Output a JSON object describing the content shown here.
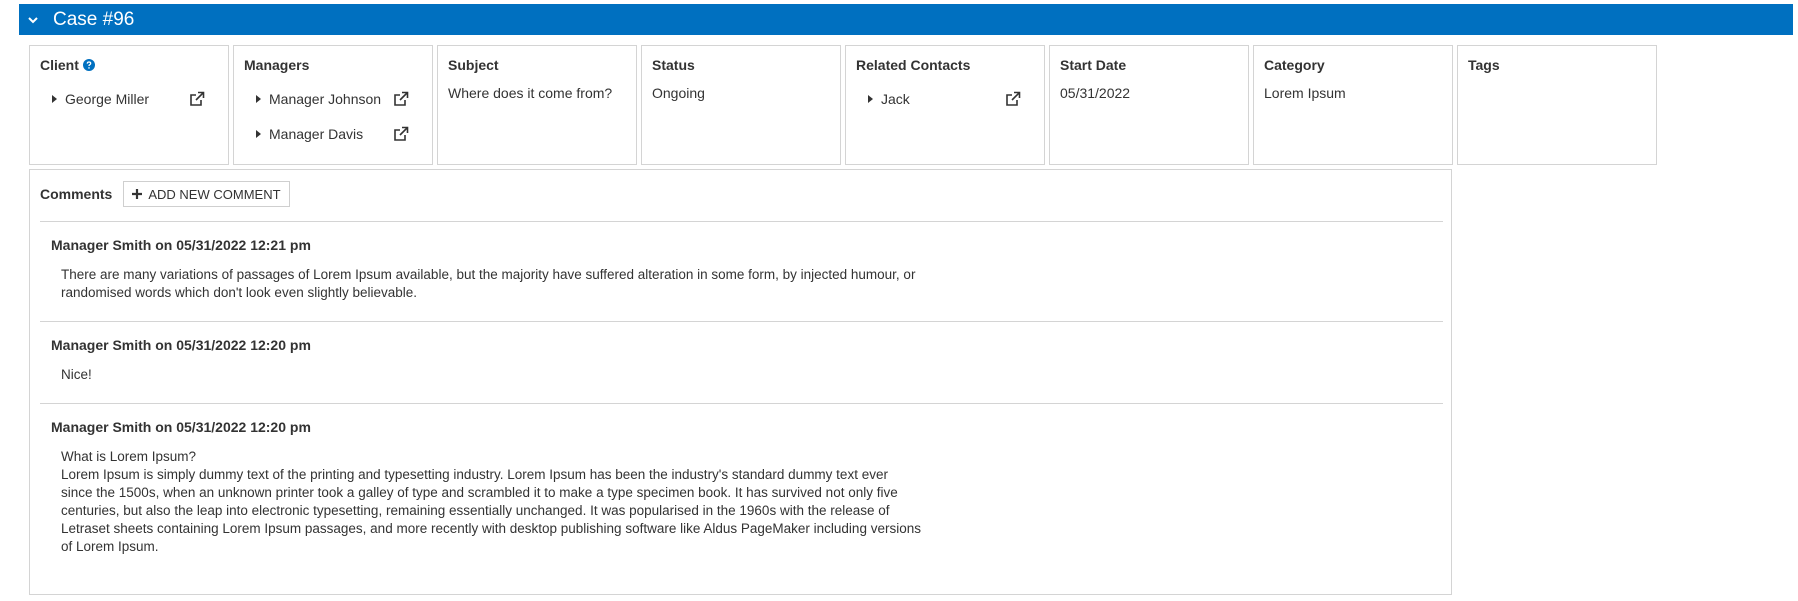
{
  "header": {
    "title": "Case #96"
  },
  "fields": {
    "client": {
      "label": "Client",
      "people": [
        {
          "name": "George Miller"
        }
      ]
    },
    "managers": {
      "label": "Managers",
      "people": [
        {
          "name": "Manager Johnson"
        },
        {
          "name": "Manager Davis"
        }
      ]
    },
    "subject": {
      "label": "Subject",
      "value": "Where does it come from?"
    },
    "status": {
      "label": "Status",
      "value": "Ongoing"
    },
    "related_contacts": {
      "label": "Related Contacts",
      "people": [
        {
          "name": "Jack"
        }
      ]
    },
    "start_date": {
      "label": "Start Date",
      "value": "05/31/2022"
    },
    "category": {
      "label": "Category",
      "value": "Lorem Ipsum"
    },
    "tags": {
      "label": "Tags"
    }
  },
  "comments": {
    "title": "Comments",
    "add_label": "ADD NEW COMMENT",
    "items": [
      {
        "author": "Manager Smith on 05/31/2022 12:21 pm",
        "body": "There are many variations of passages of Lorem Ipsum available, but the majority have suffered alteration in some form, by injected humour, or\nrandomised words which don't look even slightly believable."
      },
      {
        "author": "Manager Smith on 05/31/2022 12:20 pm",
        "body": "Nice!"
      },
      {
        "author": "Manager Smith on 05/31/2022 12:20 pm",
        "body": "What is Lorem Ipsum?\nLorem Ipsum is simply dummy text of the printing and typesetting industry. Lorem Ipsum has been the industry's standard dummy text ever\nsince the 1500s, when an unknown printer took a galley of type and scrambled it to make a type specimen book. It has survived not only five\ncenturies, but also the leap into electronic typesetting, remaining essentially unchanged. It was popularised in the 1960s with the release of\nLetraset sheets containing Lorem Ipsum passages, and more recently with desktop publishing software like Aldus PageMaker including versions\nof Lorem Ipsum."
      }
    ]
  },
  "icons": {
    "collapse": "chevron-down-icon",
    "help": "question-circle-icon",
    "expand": "caret-right-icon",
    "external": "external-link-icon",
    "add": "plus-icon"
  },
  "colors": {
    "header_bg": "#0070c0",
    "help_icon": "#0070c0",
    "border": "#d4d4d4",
    "text": "#333333"
  }
}
